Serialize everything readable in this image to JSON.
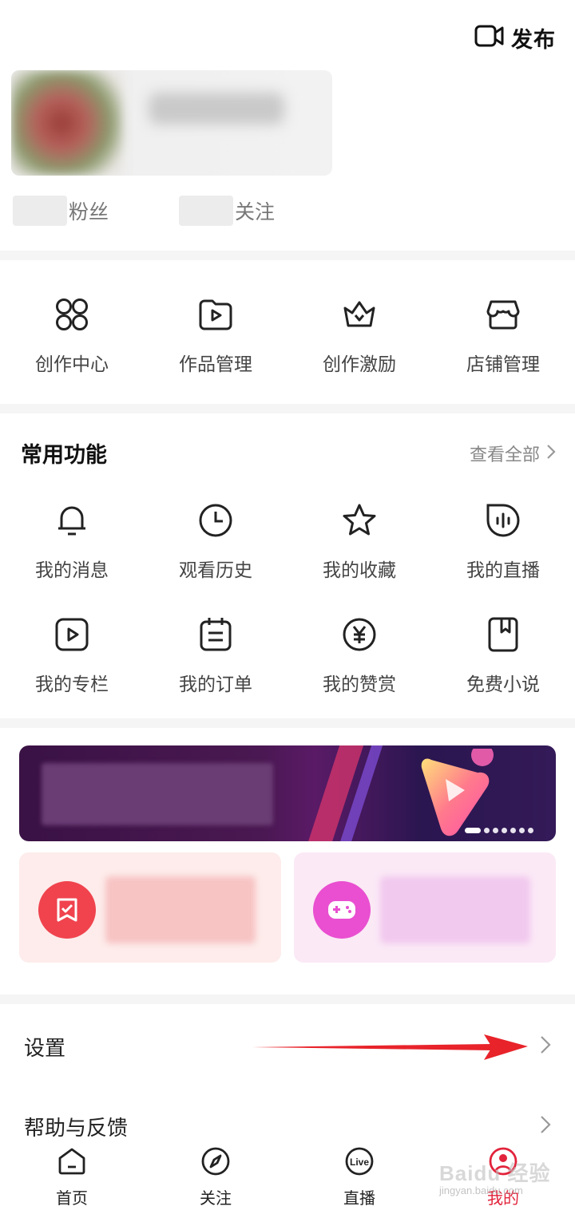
{
  "header": {
    "publish_label": "发布",
    "publish_icon": "video-camera-icon"
  },
  "profile": {
    "stats": [
      {
        "label": "粉丝"
      },
      {
        "label": "关注"
      }
    ]
  },
  "creator_tools": [
    {
      "label": "创作中心",
      "icon": "grid-four-icon"
    },
    {
      "label": "作品管理",
      "icon": "play-folder-icon"
    },
    {
      "label": "创作激励",
      "icon": "crown-icon"
    },
    {
      "label": "店铺管理",
      "icon": "store-icon"
    }
  ],
  "common": {
    "title": "常用功能",
    "see_all": "查看全部",
    "items": [
      {
        "label": "我的消息",
        "icon": "bell-icon"
      },
      {
        "label": "观看历史",
        "icon": "clock-icon"
      },
      {
        "label": "我的收藏",
        "icon": "star-icon"
      },
      {
        "label": "我的直播",
        "icon": "live-wave-icon"
      },
      {
        "label": "我的专栏",
        "icon": "play-square-icon"
      },
      {
        "label": "我的订单",
        "icon": "order-calendar-icon"
      },
      {
        "label": "我的赞赏",
        "icon": "yen-coin-icon"
      },
      {
        "label": "免费小说",
        "icon": "book-bookmark-icon"
      }
    ]
  },
  "banner": {
    "dots": 7,
    "active_dot": 0
  },
  "cards": [
    {
      "icon": "bookmark-check-icon",
      "color": "#f0434e"
    },
    {
      "icon": "gamepad-icon",
      "color": "#e94fd0"
    }
  ],
  "list": [
    {
      "label": "设置"
    },
    {
      "label": "帮助与反馈"
    }
  ],
  "bottom_nav": [
    {
      "label": "首页",
      "icon": "home-icon",
      "active": false
    },
    {
      "label": "关注",
      "icon": "compass-icon",
      "active": false
    },
    {
      "label": "直播",
      "icon": "live-icon",
      "active": false
    },
    {
      "label": "我的",
      "icon": "profile-icon",
      "active": true
    }
  ],
  "watermark": {
    "text": "Baidu 经验",
    "sub": "jingyan.baidu.com"
  },
  "colors": {
    "accent": "#e2233b",
    "annotation_arrow": "#e8232a"
  }
}
